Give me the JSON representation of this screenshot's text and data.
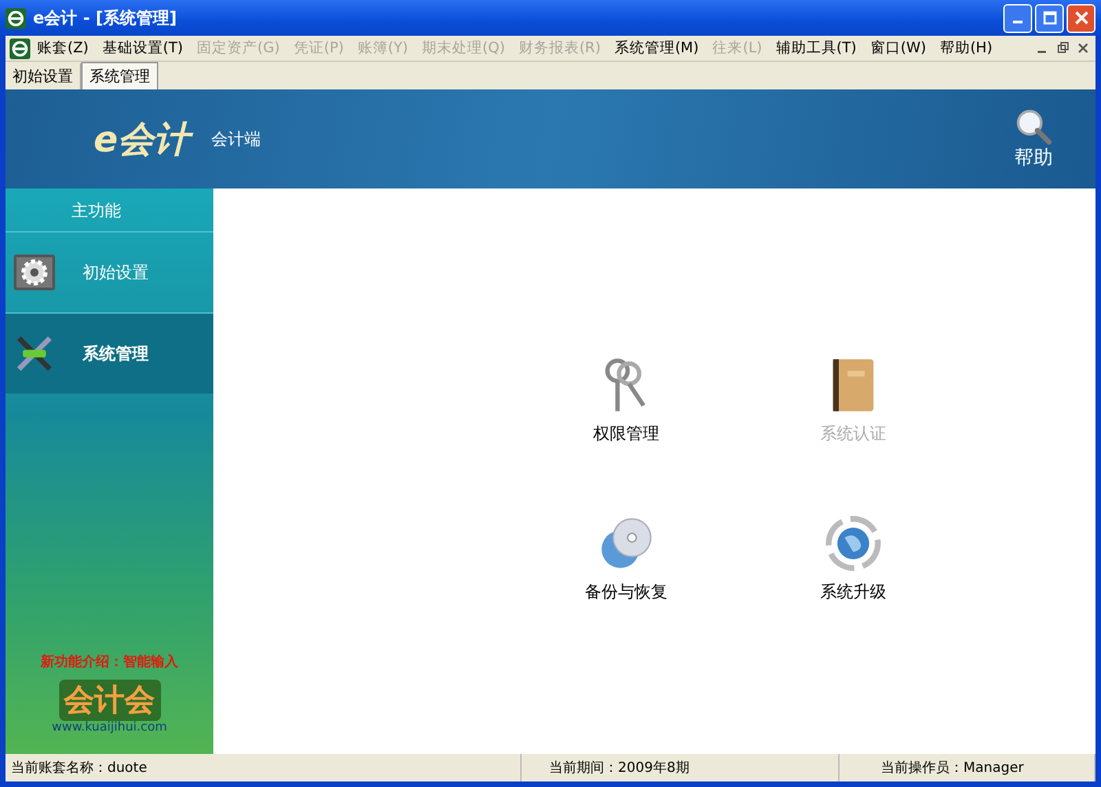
{
  "window": {
    "title": "e会计 - [系统管理]"
  },
  "menu": [
    {
      "label": "账套(Z)",
      "disabled": false
    },
    {
      "label": "基础设置(T)",
      "disabled": false
    },
    {
      "label": "固定资产(G)",
      "disabled": true
    },
    {
      "label": "凭证(P)",
      "disabled": true
    },
    {
      "label": "账簿(Y)",
      "disabled": true
    },
    {
      "label": "期末处理(Q)",
      "disabled": true
    },
    {
      "label": "财务报表(R)",
      "disabled": true
    },
    {
      "label": "系统管理(M)",
      "disabled": false
    },
    {
      "label": "往来(L)",
      "disabled": true
    },
    {
      "label": "辅助工具(T)",
      "disabled": false
    },
    {
      "label": "窗口(W)",
      "disabled": false
    },
    {
      "label": "帮助(H)",
      "disabled": false
    }
  ],
  "tabs": [
    {
      "label": "初始设置",
      "selected": false
    },
    {
      "label": "系统管理",
      "selected": true
    }
  ],
  "header": {
    "logo": "e会计",
    "subtitle": "会计端",
    "help": "帮助"
  },
  "sidebar": {
    "title": "主功能",
    "items": [
      {
        "label": "初始设置",
        "kind": "gear",
        "selected": false
      },
      {
        "label": "系统管理",
        "kind": "tools",
        "selected": true
      }
    ],
    "promo": "新功能介绍：智能输入",
    "promo_logo": "会计会",
    "promo_url": "www.kuaijihui.com"
  },
  "functions": [
    {
      "label": "权限管理",
      "kind": "keys",
      "disabled": false
    },
    {
      "label": "系统认证",
      "kind": "book",
      "disabled": true
    },
    {
      "label": "备份与恢复",
      "kind": "disc",
      "disabled": false
    },
    {
      "label": "系统升级",
      "kind": "globe",
      "disabled": false
    }
  ],
  "status_bar": [
    "当前账套名称：duote",
    "当前期间：2009年8期",
    "当前操作员：Manager"
  ]
}
